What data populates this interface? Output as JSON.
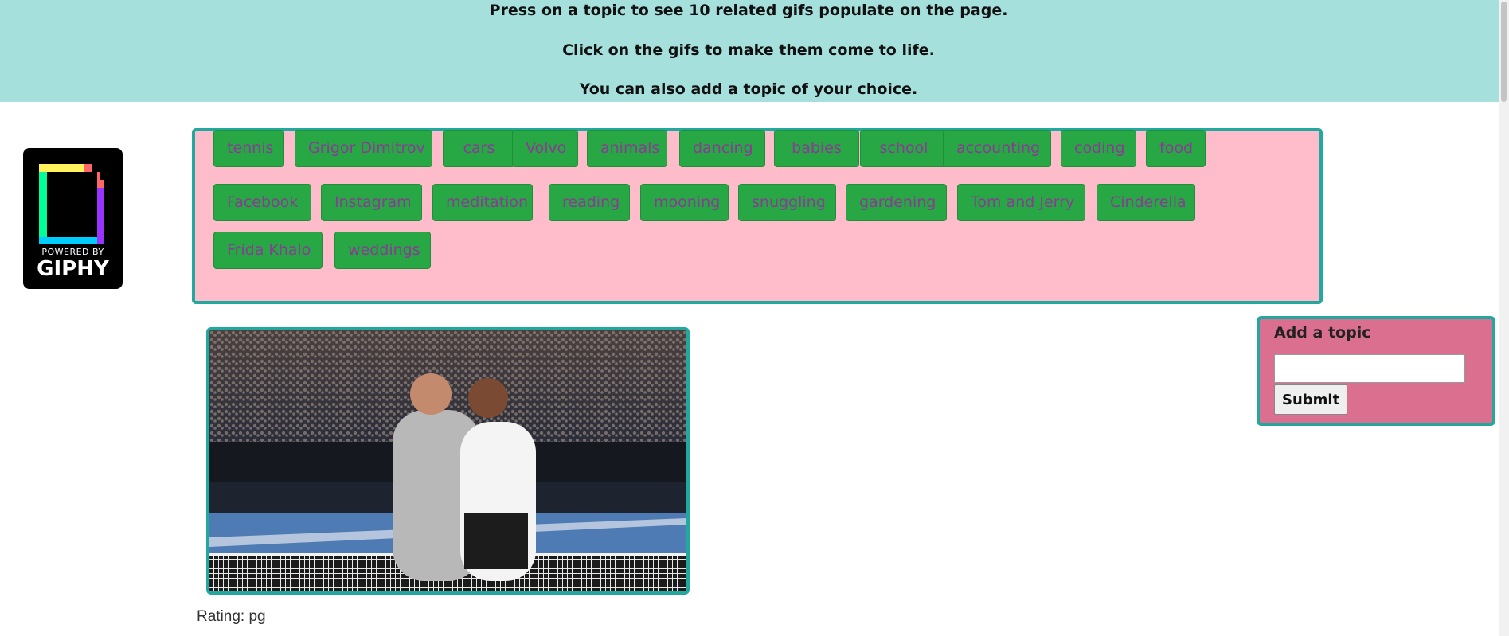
{
  "header": {
    "line1": "Press on a topic to see 10 related gifs populate on the page.",
    "line2": "Click on the gifs to make them come to life.",
    "line3": "You can also add a topic of your choice."
  },
  "logo": {
    "powered_by": "POWERED BY",
    "brand": "GIPHY"
  },
  "topics": [
    "tennis",
    "Grigor Dimitrov",
    "cars",
    "Volvo",
    "animals",
    "dancing",
    "babies",
    "school",
    "accounting",
    "coding",
    "food",
    "Facebook",
    "Instagram",
    "meditation",
    "reading",
    "mooning",
    "snuggling",
    "gardening",
    "Tom and Jerry",
    "Cinderella",
    "Frida Khalo",
    "weddings"
  ],
  "gif": {
    "rating": "Rating: pg"
  },
  "add_topic": {
    "title": "Add a topic",
    "input_value": "",
    "submit_label": "Submit"
  },
  "colors": {
    "header_bg": "#a6e0dc",
    "topics_bg": "#ffbccb",
    "button_bg": "#28a745",
    "button_text": "#8b3a96",
    "border": "#23a8a0",
    "add_bg": "#db6f8f"
  }
}
